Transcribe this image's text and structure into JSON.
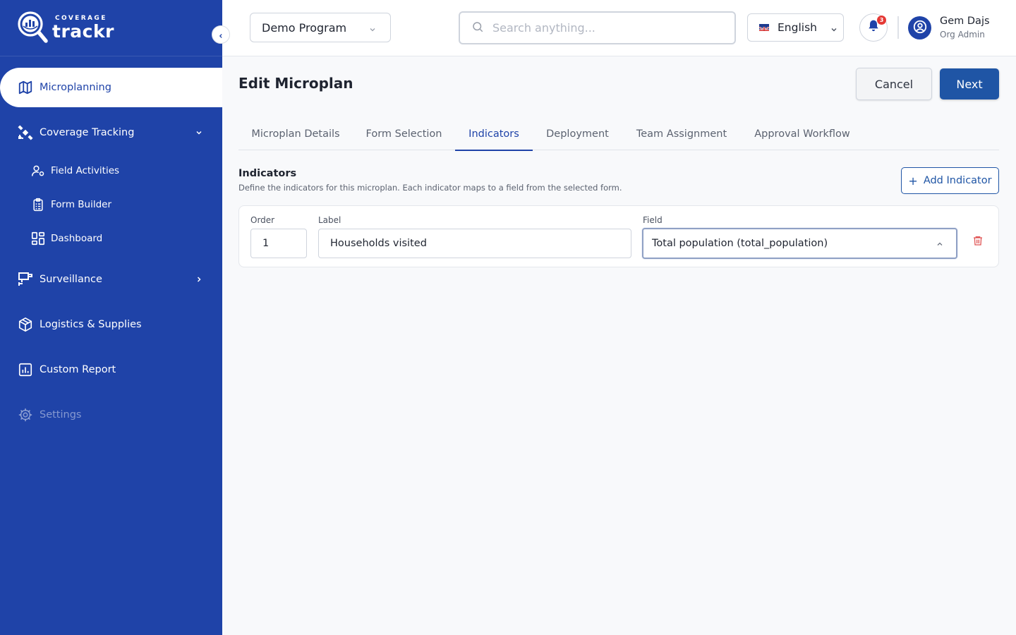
{
  "brand": {
    "logo_small": "COVERAGE",
    "logo_big": "trackr"
  },
  "sidebar": {
    "items": [
      {
        "label": "Microplanning",
        "icon": "map-icon",
        "active": true
      },
      {
        "label": "Coverage Tracking",
        "icon": "satellite-icon",
        "expanded": true
      },
      {
        "label": "Surveillance",
        "icon": "monitor-camera-icon"
      },
      {
        "label": "Logistics & Supplies",
        "icon": "package-icon"
      },
      {
        "label": "Custom Report",
        "icon": "bar-chart-icon"
      },
      {
        "label": "Settings",
        "icon": "gear-icon",
        "disabled": true
      }
    ],
    "sub_items": [
      {
        "label": "Field Activities",
        "icon": "user-settings-icon"
      },
      {
        "label": "Form Builder",
        "icon": "clipboard-icon"
      },
      {
        "label": "Dashboard",
        "icon": "dashboard-icon"
      }
    ]
  },
  "topbar": {
    "program": "Demo Program",
    "search_placeholder": "Search anything...",
    "language": "English",
    "notifications_count": "3",
    "user_name": "Gem Dajs",
    "user_role": "Org Admin"
  },
  "page": {
    "title": "Edit Microplan",
    "cancel_label": "Cancel",
    "next_label": "Next"
  },
  "tabs": [
    {
      "label": "Microplan Details"
    },
    {
      "label": "Form Selection"
    },
    {
      "label": "Indicators",
      "active": true
    },
    {
      "label": "Deployment"
    },
    {
      "label": "Team Assignment"
    },
    {
      "label": "Approval Workflow"
    }
  ],
  "indicators": {
    "title": "Indicators",
    "description": "Define the indicators for this microplan. Each indicator maps to a field from the selected form.",
    "add_label": "Add Indicator",
    "add_symbol": "+",
    "columns": {
      "order": "Order",
      "label": "Label",
      "field": "Field"
    },
    "rows": [
      {
        "order": "1",
        "label": "Households visited",
        "field": "Total population (total_population)"
      }
    ]
  },
  "colors": {
    "sidebar_bg": "#1f43a8",
    "primary": "#1f55a5",
    "danger": "#e05555"
  }
}
